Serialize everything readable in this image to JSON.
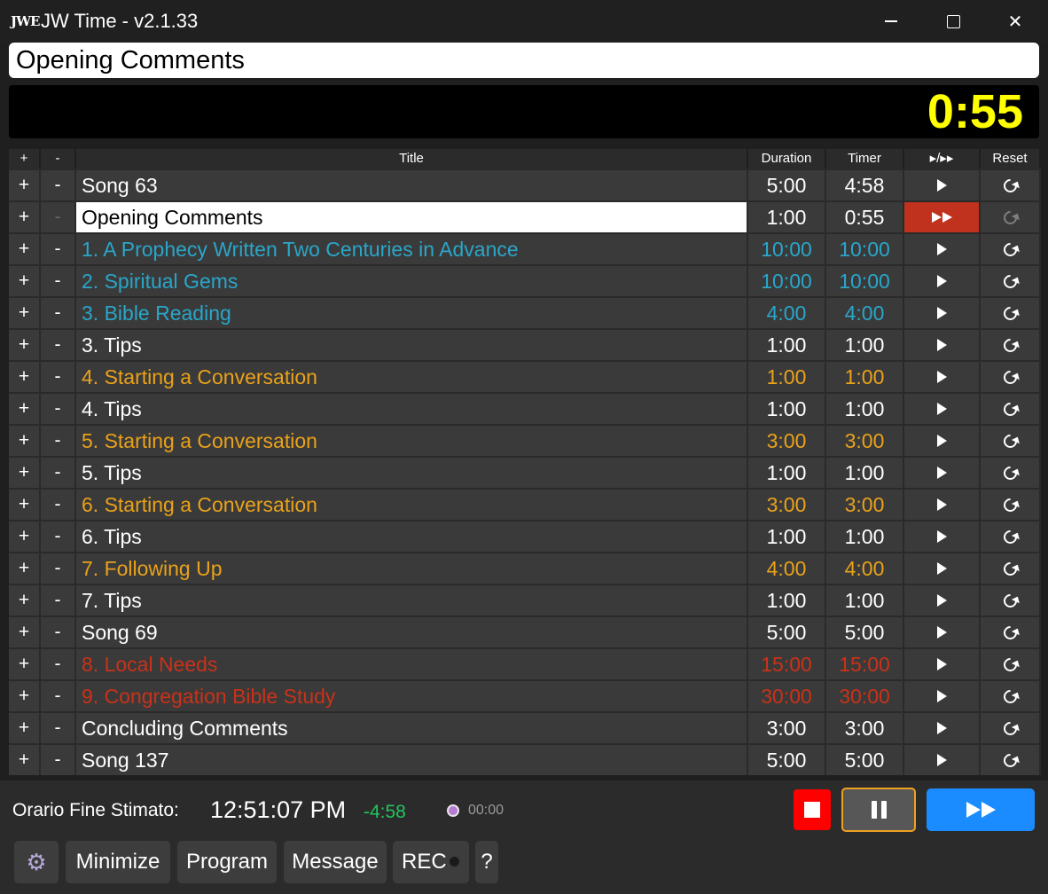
{
  "window": {
    "logo": "JWE",
    "title": "JW Time - v2.1.33"
  },
  "current_item": "Opening Comments",
  "clock": "0:55",
  "table": {
    "headers": [
      "+",
      "-",
      "Title",
      "Duration",
      "Timer",
      "▸/▸▸",
      "Reset"
    ],
    "plus_label": "+",
    "minus_label": "-",
    "rows": [
      {
        "title": "Song 63",
        "duration": "5:00",
        "timer": "4:58",
        "color": "#ffffff",
        "active": false
      },
      {
        "title": "Opening Comments",
        "duration": "1:00",
        "timer": "0:55",
        "color": "#000000",
        "active": true
      },
      {
        "title": "1. A Prophecy Written Two Centuries in Advance",
        "duration": "10:00",
        "timer": "10:00",
        "color": "#2aa6c9",
        "active": false
      },
      {
        "title": "2. Spiritual Gems",
        "duration": "10:00",
        "timer": "10:00",
        "color": "#2aa6c9",
        "active": false
      },
      {
        "title": "3. Bible Reading",
        "duration": "4:00",
        "timer": "4:00",
        "color": "#2aa6c9",
        "active": false
      },
      {
        "title": "3. Tips",
        "duration": "1:00",
        "timer": "1:00",
        "color": "#ffffff",
        "active": false
      },
      {
        "title": "4. Starting a Conversation",
        "duration": "1:00",
        "timer": "1:00",
        "color": "#e9a21b",
        "active": false
      },
      {
        "title": "4. Tips",
        "duration": "1:00",
        "timer": "1:00",
        "color": "#ffffff",
        "active": false
      },
      {
        "title": "5. Starting a Conversation",
        "duration": "3:00",
        "timer": "3:00",
        "color": "#e9a21b",
        "active": false
      },
      {
        "title": "5. Tips",
        "duration": "1:00",
        "timer": "1:00",
        "color": "#ffffff",
        "active": false
      },
      {
        "title": "6. Starting a Conversation",
        "duration": "3:00",
        "timer": "3:00",
        "color": "#e9a21b",
        "active": false
      },
      {
        "title": "6. Tips",
        "duration": "1:00",
        "timer": "1:00",
        "color": "#ffffff",
        "active": false
      },
      {
        "title": "7. Following Up",
        "duration": "4:00",
        "timer": "4:00",
        "color": "#e9a21b",
        "active": false
      },
      {
        "title": "7. Tips",
        "duration": "1:00",
        "timer": "1:00",
        "color": "#ffffff",
        "active": false
      },
      {
        "title": "Song 69",
        "duration": "5:00",
        "timer": "5:00",
        "color": "#ffffff",
        "active": false
      },
      {
        "title": "8. Local Needs",
        "duration": "15:00",
        "timer": "15:00",
        "color": "#c93219",
        "active": false
      },
      {
        "title": "9. Congregation Bible Study",
        "duration": "30:00",
        "timer": "30:00",
        "color": "#c93219",
        "active": false
      },
      {
        "title": "Concluding Comments",
        "duration": "3:00",
        "timer": "3:00",
        "color": "#ffffff",
        "active": false
      },
      {
        "title": "Song 137",
        "duration": "5:00",
        "timer": "5:00",
        "color": "#ffffff",
        "active": false
      }
    ]
  },
  "footer": {
    "estimated_label": "Orario Fine Stimato:",
    "estimated_time": "12:51:07 PM",
    "difference": "-4:58",
    "alarm_time": "00:00",
    "buttons": {
      "settings_icon": "gear-icon",
      "minimize": "Minimize",
      "program": "Program",
      "message": "Message",
      "rec": "REC",
      "help": "?"
    }
  },
  "colors": {
    "clock": "#ffff00",
    "stop": "#ff0000",
    "pause_border": "#f0a020",
    "next": "#1a8cff",
    "active_play": "#c0321e",
    "difference": "#22c55e"
  }
}
